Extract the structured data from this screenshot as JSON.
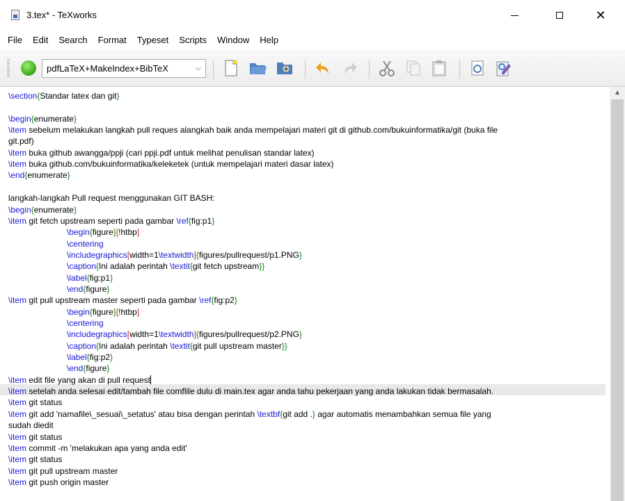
{
  "window": {
    "title": "3.tex* - TeXworks"
  },
  "menu": [
    "File",
    "Edit",
    "Search",
    "Format",
    "Typeset",
    "Scripts",
    "Window",
    "Help"
  ],
  "toolbar": {
    "engine": "pdfLaTeX+MakeIndex+BibTeX"
  },
  "colors": {
    "command": "#1919d2",
    "group": "#128212",
    "option": "#c42b1c"
  },
  "editor": {
    "lines": [
      "\\section{Standar latex dan git}",
      "",
      "\\begin{enumerate}",
      "\\item sebelum melakukan langkah pull reques alangkah baik anda mempelajari materi git di github.com/bukuinformatika/git (buka file",
      "git.pdf)",
      "\\item buka github awangga/ppji (cari ppji.pdf untuk melihat penulisan standar latex)",
      "\\item buka github.com/bukuinformatika/keleketek (untuk mempelajari materi dasar latex)",
      "\\end{enumerate}",
      "",
      " langkah-langkah Pull request menggunakan GIT BASH:",
      "\\begin{enumerate}",
      "\\item git fetch upstream seperti pada gambar \\ref{fig:p1}",
      "\t\\begin{figure}[!htbp]",
      "\t\\centering",
      "\t\\includegraphics[width=1\\textwidth]{figures/pullrequest/p1.PNG}",
      "\t\\caption{Ini adalah perintah \\textit{git fetch upstream}}",
      "\t\\label{fig:p1}",
      "\t\\end{figure}",
      "\\item git pull upstream master seperti pada gambar \\ref{fig:p2}",
      "\t\\begin{figure}[!htbp]",
      "\t\\centering",
      "\t\\includegraphics[width=1\\textwidth]{figures/pullrequest/p2.PNG}",
      "\t\\caption{Ini adalah perintah \\textit{git pull upstream master}}",
      "\t\\label{fig:p2}",
      "\t\\end{figure}",
      "\\item edit file yang akan di pull request",
      "\\item setelah anda selesai edit/tambah file comflile dulu di main.tex agar anda tahu pekerjaan yang anda lakukan tidak bermasalah.",
      "\\item git status",
      "\\item git add 'namafile\\_sesuai\\_setatus' atau bisa dengan perintah \\textbf{git add .} agar automatis menambahkan semua file yang",
      "sudah diedit",
      "\\item git status",
      "\\item commit -m 'melakukan apa yang anda edit'",
      "\\item git status",
      "\\item git pull upstream master",
      "\\item git push origin master"
    ]
  }
}
